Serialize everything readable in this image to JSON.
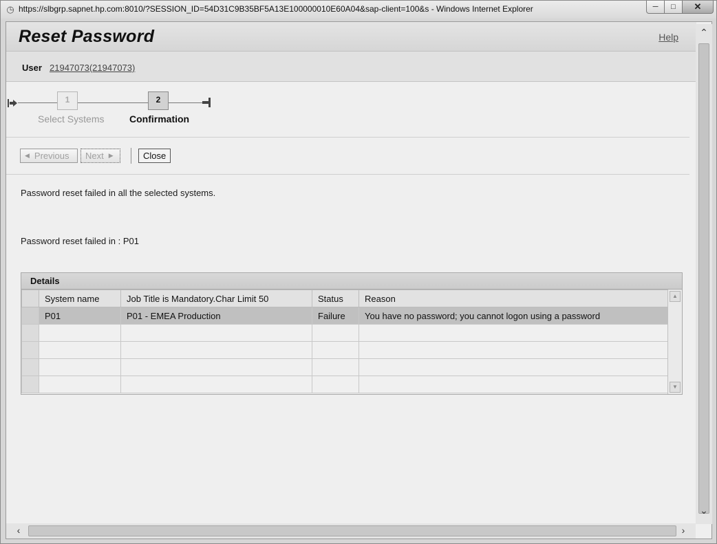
{
  "window": {
    "title": "https://slbgrp.sapnet.hp.com:8010/?SESSION_ID=54D31C9B35BF5A13E100000010E60A04&sap-client=100&s - Windows Internet Explorer"
  },
  "header": {
    "title": "Reset Password",
    "help_label": "Help"
  },
  "user": {
    "label": "User",
    "value": "21947073(21947073)"
  },
  "roadmap": {
    "steps": [
      {
        "number": "1",
        "label": "Select Systems",
        "active": false
      },
      {
        "number": "2",
        "label": "Confirmation",
        "active": true
      }
    ]
  },
  "toolbar": {
    "previous_label": "Previous",
    "next_label": "Next",
    "close_label": "Close"
  },
  "messages": {
    "summary": "Password reset failed in all the selected systems.",
    "failed_in": "Password reset failed in : P01"
  },
  "details": {
    "title": "Details",
    "columns": [
      "System name",
      "Job Title is Mandatory.Char Limit 50",
      "Status",
      "Reason"
    ],
    "rows": [
      [
        "P01",
        "P01 - EMEA Production",
        "Failure",
        "You have no password; you cannot logon using a password"
      ],
      [
        "",
        "",
        "",
        ""
      ],
      [
        "",
        "",
        "",
        ""
      ],
      [
        "",
        "",
        "",
        ""
      ],
      [
        "",
        "",
        "",
        ""
      ]
    ]
  },
  "icons": {
    "browser": "ie-page-icon",
    "roadmap_start": "roadmap-start-icon",
    "roadmap_end": "roadmap-end-icon"
  }
}
